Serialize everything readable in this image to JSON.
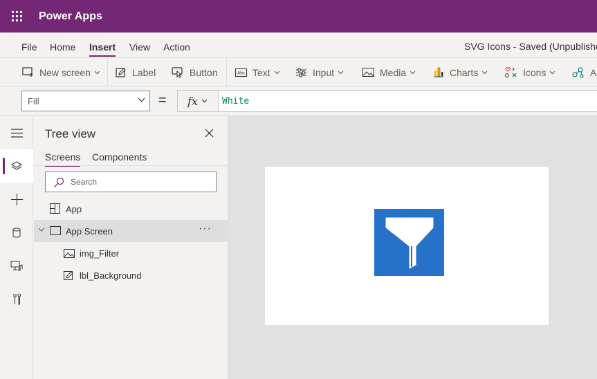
{
  "app": {
    "name": "Power Apps"
  },
  "menu": {
    "items": [
      "File",
      "Home",
      "Insert",
      "View",
      "Action"
    ],
    "active": "Insert",
    "doc_status": "SVG Icons - Saved (Unpublished)"
  },
  "toolbar": {
    "new_screen": "New screen",
    "label": "Label",
    "button": "Button",
    "text": "Text",
    "input": "Input",
    "media": "Media",
    "charts": "Charts",
    "icons": "Icons",
    "ai": "AI"
  },
  "formula": {
    "property": "Fill",
    "equals": "=",
    "fx": "fx",
    "value": "White"
  },
  "tree": {
    "title": "Tree view",
    "tabs": [
      "Screens",
      "Components"
    ],
    "search_placeholder": "Search",
    "items": [
      {
        "label": "App",
        "icon": "app-grid-icon"
      },
      {
        "label": "App Screen",
        "icon": "screen-icon",
        "more": "···"
      },
      {
        "label": "img_Filter",
        "icon": "image-icon"
      },
      {
        "label": "lbl_Background",
        "icon": "label-edit-icon"
      }
    ]
  },
  "colors": {
    "brand": "#742774",
    "canvas_bg": "#e1e1e1",
    "filter_bg": "#2672c8",
    "formula_value": "#098658"
  }
}
